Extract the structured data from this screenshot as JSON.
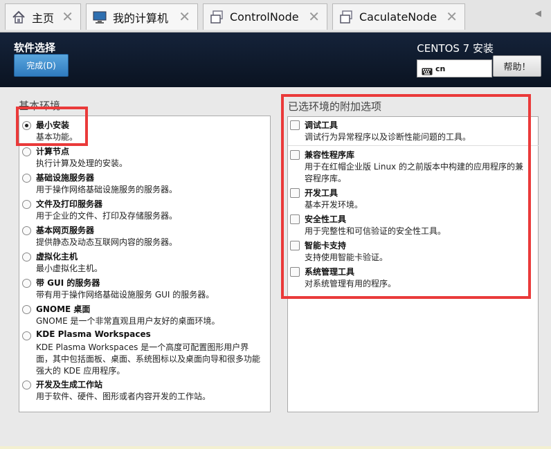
{
  "tabs": [
    {
      "label": "主页",
      "icon": "home-icon"
    },
    {
      "label": "我的计算机",
      "icon": "computer-icon"
    },
    {
      "label": "ControlNode",
      "icon": "vm-icon"
    },
    {
      "label": "CaculateNode",
      "icon": "vm-icon"
    }
  ],
  "tab_close_glyph": "✕",
  "tab_scroll_glyph": "◀",
  "header": {
    "page_title": "软件选择",
    "done_label": "完成(D)",
    "install_title": "CENTOS 7 安装",
    "keyboard_value": "cn",
    "help_label": "帮助！"
  },
  "base_env": {
    "title": "基本环境",
    "items": [
      {
        "name": "最小安装",
        "desc": "基本功能。",
        "checked": true
      },
      {
        "name": "计算节点",
        "desc": "执行计算及处理的安装。"
      },
      {
        "name": "基础设施服务器",
        "desc": "用于操作网络基础设施服务的服务器。"
      },
      {
        "name": "文件及打印服务器",
        "desc": "用于企业的文件、打印及存储服务器。"
      },
      {
        "name": "基本网页服务器",
        "desc": "提供静态及动态互联网内容的服务器。"
      },
      {
        "name": "虚拟化主机",
        "desc": "最小虚拟化主机。"
      },
      {
        "name": "带 GUI 的服务器",
        "desc": "带有用于操作网络基础设施服务 GUI 的服务器。"
      },
      {
        "name": "GNOME 桌面",
        "desc": "GNOME 是一个非常直观且用户友好的桌面环境。"
      },
      {
        "name": "KDE Plasma Workspaces",
        "desc": "KDE Plasma Workspaces 是一个高度可配置图形用户界面，其中包括面板、桌面、系统图标以及桌面向导和很多功能强大的 KDE 应用程序。"
      },
      {
        "name": "开发及生成工作站",
        "desc": "用于软件、硬件、图形或者内容开发的工作站。"
      }
    ]
  },
  "addons": {
    "title": "已选环境的附加选项",
    "items": [
      {
        "name": "调试工具",
        "desc": "调试行为异常程序以及诊断性能问题的工具。"
      },
      {
        "name": "兼容性程序库",
        "desc": "用于在红帽企业版 Linux 的之前版本中构建的应用程序的兼容程序库。"
      },
      {
        "name": "开发工具",
        "desc": "基本开发环境。"
      },
      {
        "name": "安全性工具",
        "desc": "用于完整性和可信验证的安全性工具。"
      },
      {
        "name": "智能卡支持",
        "desc": "支持使用智能卡验证。"
      },
      {
        "name": "系统管理工具",
        "desc": "对系统管理有用的程序。"
      }
    ]
  },
  "colors": {
    "header_bg": "#0f1b2d",
    "accent": "#3a8ad0",
    "annotation": "#ea3a3a"
  }
}
